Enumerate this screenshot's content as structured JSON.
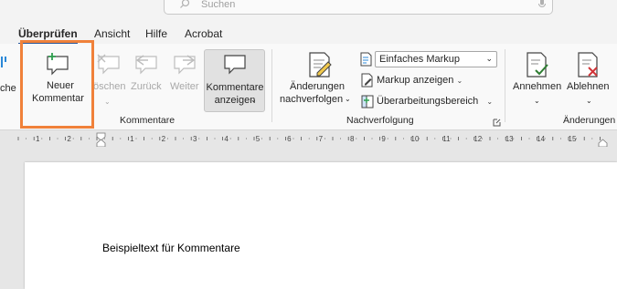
{
  "search": {
    "placeholder": "Suchen"
  },
  "menu_tabs": [
    {
      "label": "Überprüfen",
      "active": true
    },
    {
      "label": "Ansicht",
      "active": false
    },
    {
      "label": "Hilfe",
      "active": false
    },
    {
      "label": "Acrobat",
      "active": false
    }
  ],
  "ribbon": {
    "partial_left_label": "che",
    "comments_group": {
      "label": "Kommentare",
      "new_comment": {
        "line1": "Neuer",
        "line2": "Kommentar"
      },
      "delete": {
        "label": "öschen"
      },
      "previous": {
        "label": "Zurück"
      },
      "next": {
        "label": "Weiter"
      },
      "show_comments": {
        "line1": "Kommentare",
        "line2": "anzeigen"
      }
    },
    "tracking_group": {
      "label": "Nachverfolgung",
      "track_changes": {
        "line1": "Änderungen",
        "line2": "nachverfolgen"
      },
      "markup_select": {
        "value": "Einfaches Markup"
      },
      "show_markup": {
        "label": "Markup anzeigen"
      },
      "revision_pane": {
        "label": "Überarbeitungsbereich"
      }
    },
    "changes_group": {
      "label": "Änderungen",
      "accept": {
        "label": "Annehmen"
      },
      "reject": {
        "label": "Ablehnen"
      }
    }
  },
  "ruler": {
    "numbers": [
      "1",
      "2",
      "1",
      "2",
      "3",
      "4",
      "5",
      "6",
      "7",
      "8",
      "9",
      "10",
      "11",
      "12",
      "13",
      "14",
      "15"
    ]
  },
  "document": {
    "text": "Beispieltext für Kommentare"
  },
  "colors": {
    "highlight": "#f0813a",
    "accent_blue": "#2b579a",
    "reject_red": "#d13438",
    "accept_green": "#2e7d32"
  }
}
